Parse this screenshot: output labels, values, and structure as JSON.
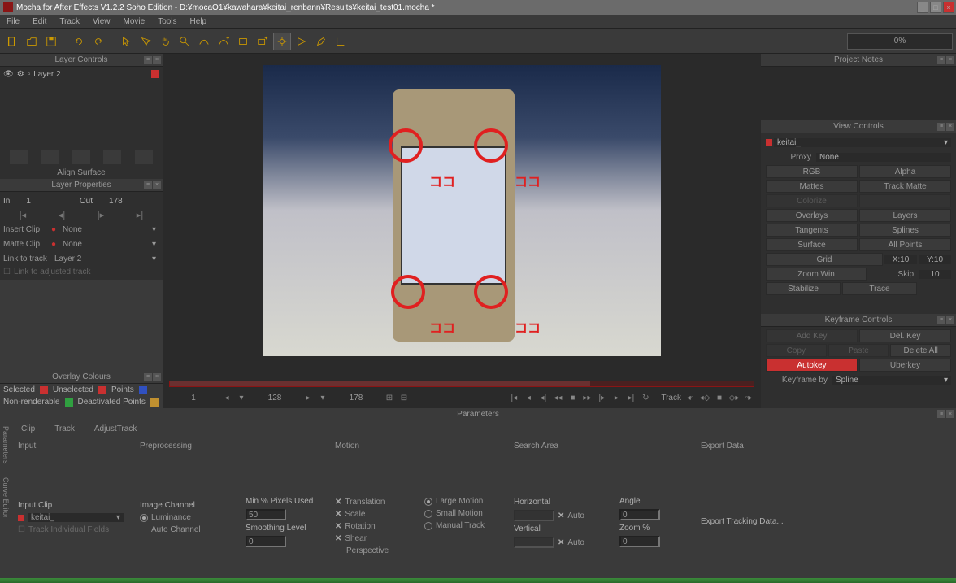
{
  "titlebar": "Mocha for After Effects V1.2.2 Soho Edition - D:¥mocaO1¥kawahara¥keitai_renbann¥Results¥keitai_test01.mocha *",
  "menu": [
    "File",
    "Edit",
    "Track",
    "View",
    "Movie",
    "Tools",
    "Help"
  ],
  "progress": "0%",
  "panels": {
    "layer_controls": "Layer Controls",
    "layer_properties": "Layer Properties",
    "overlay_colours": "Overlay Colours",
    "project_notes": "Project Notes",
    "view_controls": "View Controls",
    "keyframe_controls": "Keyframe Controls",
    "parameters": "Parameters"
  },
  "layers": {
    "item1": "Layer 2"
  },
  "align_surface": "Align Surface",
  "in_out": {
    "in_lbl": "In",
    "in_val": "1",
    "out_lbl": "Out",
    "out_val": "178"
  },
  "props": {
    "insert_clip": "Insert Clip",
    "insert_val": "None",
    "matte_clip": "Matte Clip",
    "matte_val": "None",
    "link_track": "Link to track",
    "link_val": "Layer 2",
    "link_adjusted": "Link to adjusted track"
  },
  "colours": {
    "selected": "Selected",
    "unselected": "Unselected",
    "points": "Points",
    "nonrender": "Non-renderable",
    "deact": "Deactivated Points"
  },
  "timeline": {
    "f1": "1",
    "f2": "128",
    "f3": "178",
    "track": "Track"
  },
  "view": {
    "keitai": "keitai_",
    "proxy": "Proxy",
    "proxy_val": "None",
    "rgb": "RGB",
    "alpha": "Alpha",
    "mattes": "Mattes",
    "track_matte": "Track Matte",
    "overlays": "Overlays",
    "layers": "Layers",
    "tangents": "Tangents",
    "splines": "Splines",
    "surface": "Surface",
    "all_points": "All Points",
    "grid": "Grid",
    "x": "X:10",
    "y": "Y:10",
    "zoom": "Zoom Win",
    "skip": "Skip",
    "skip_val": "10",
    "stabilize": "Stabilize",
    "trace": "Trace"
  },
  "keyframe": {
    "add": "Add Key",
    "del": "Del. Key",
    "copy": "Copy",
    "paste": "Paste",
    "delall": "Delete All",
    "autokey": "Autokey",
    "uberkey": "Uberkey",
    "by": "Keyframe by",
    "spline": "Spline"
  },
  "param_tabs": {
    "clip": "Clip",
    "track": "Track",
    "adjust": "AdjustTrack"
  },
  "params": {
    "input": "Input",
    "preprocessing": "Preprocessing",
    "motion": "Motion",
    "search": "Search Area",
    "export": "Export Data",
    "input_clip": "Input Clip",
    "keitai": "keitai_",
    "image_channel": "Image Channel",
    "luminance": "Luminance",
    "auto_channel": "Auto Channel",
    "min_pixels": "Min % Pixels Used",
    "min_val": "50",
    "smooth": "Smoothing Level",
    "smooth_val": "0",
    "translation": "Translation",
    "scale": "Scale",
    "rotation": "Rotation",
    "shear": "Shear",
    "perspective": "Perspective",
    "large": "Large Motion",
    "small": "Small Motion",
    "manual": "Manual Track",
    "horizontal": "Horizontal",
    "vertical": "Vertical",
    "auto": "Auto",
    "angle": "Angle",
    "angle_val": "0",
    "zoom": "Zoom %",
    "zoom_val": "0",
    "export_btn": "Export Tracking Data...",
    "track_fields": "Track Individual Fields"
  },
  "side_tabs": {
    "params": "Parameters",
    "curve": "Curve Editor"
  }
}
